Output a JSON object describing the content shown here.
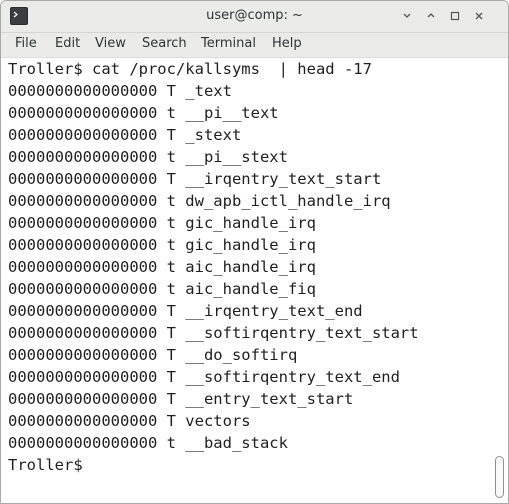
{
  "window": {
    "title": "user@comp: ~",
    "controls": {
      "minimize": "‹",
      "restore": "˄",
      "maximize": "□",
      "close": "×"
    }
  },
  "menu": [
    "File",
    "Edit",
    "View",
    "Search",
    "Terminal",
    "Help"
  ],
  "terminal": {
    "lines": [
      "Troller$ cat /proc/kallsyms  | head -17",
      "0000000000000000 T _text",
      "0000000000000000 t __pi__text",
      "0000000000000000 T _stext",
      "0000000000000000 t __pi__stext",
      "0000000000000000 T __irqentry_text_start",
      "0000000000000000 t dw_apb_ictl_handle_irq",
      "0000000000000000 t gic_handle_irq",
      "0000000000000000 t gic_handle_irq",
      "0000000000000000 t aic_handle_irq",
      "0000000000000000 t aic_handle_fiq",
      "0000000000000000 T __irqentry_text_end",
      "0000000000000000 T __softirqentry_text_start",
      "0000000000000000 T __do_softirq",
      "0000000000000000 T __softirqentry_text_end",
      "0000000000000000 T __entry_text_start",
      "0000000000000000 T vectors",
      "0000000000000000 t __bad_stack",
      "Troller$ "
    ]
  },
  "icons": {
    "app": "terminal-app-icon",
    "scrollbar": "scrollbar-thumb"
  }
}
